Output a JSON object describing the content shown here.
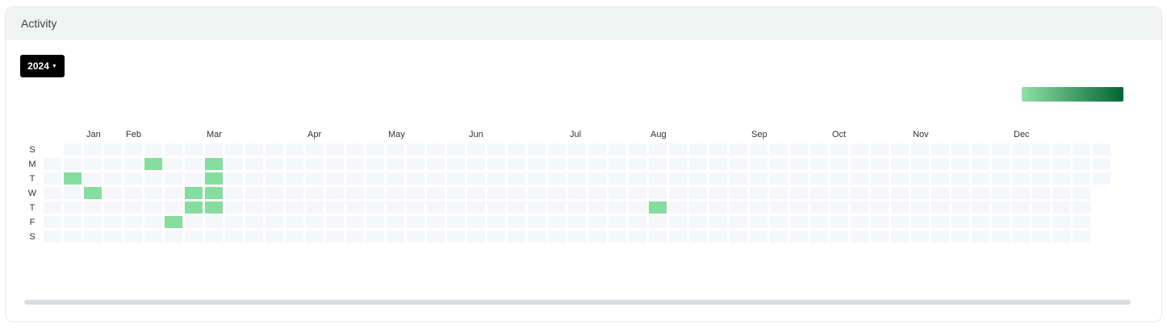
{
  "card": {
    "title": "Activity"
  },
  "year_selector": {
    "selected": "2024"
  },
  "legend": {
    "color_low": "#8fe0a4",
    "color_high": "#006633"
  },
  "colors": {
    "empty_cell": "#f6f7fa",
    "active_cell": "#86de9e"
  },
  "heatmap": {
    "year": 2024,
    "day_labels": [
      "S",
      "M",
      "T",
      "W",
      "T",
      "F",
      "S"
    ],
    "month_labels": [
      "Jan",
      "Feb",
      "Mar",
      "Apr",
      "May",
      "Jun",
      "Jul",
      "Aug",
      "Sep",
      "Oct",
      "Nov",
      "Dec"
    ],
    "active_dates": [
      "2024-01-09",
      "2024-01-17",
      "2024-02-05",
      "2024-02-16",
      "2024-02-21",
      "2024-02-22",
      "2024-02-26",
      "2024-02-27",
      "2024-02-28",
      "2024-02-29",
      "2024-08-01"
    ]
  }
}
